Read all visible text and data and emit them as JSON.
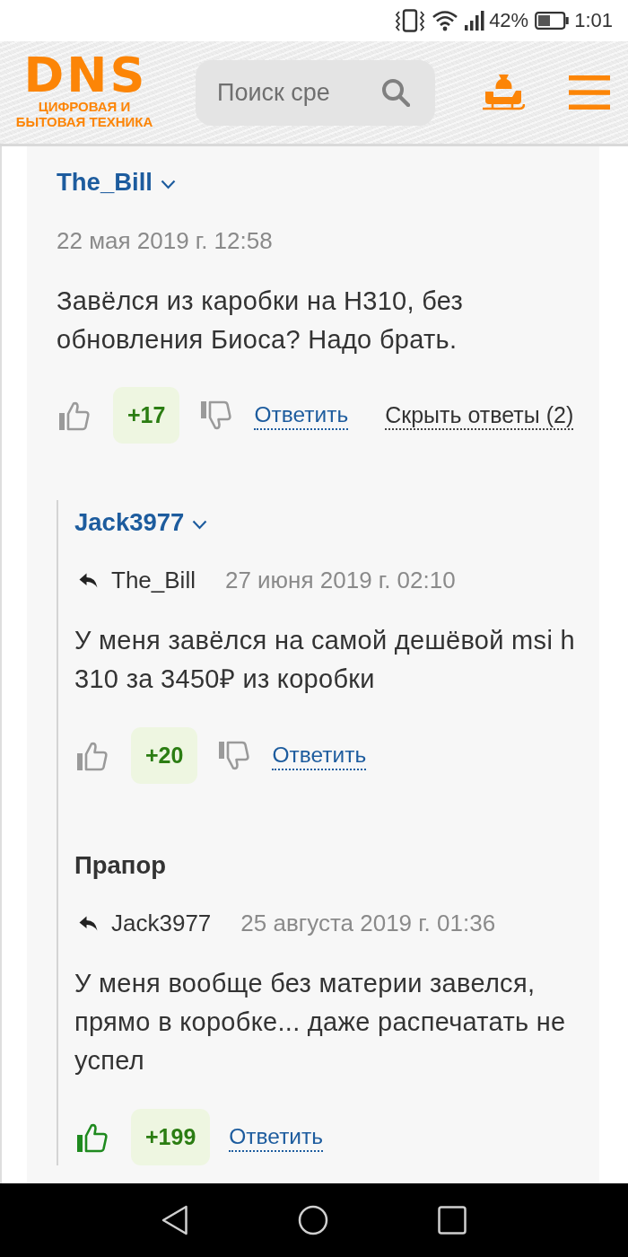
{
  "status_bar": {
    "battery": "42%",
    "time": "1:01"
  },
  "header": {
    "logo": {
      "wordmark": "DNS",
      "tagline": [
        "ЦИФРОВАЯ И",
        "БЫТОВАЯ ТЕХНИКА"
      ]
    },
    "search": {
      "placeholder": "Поиск сре"
    }
  },
  "comments": [
    {
      "author": "The_Bill",
      "author_link": true,
      "date": "22 мая 2019 г. 12:58",
      "text": "Завёлся из каробки на H310, без обновления Биоса? Надо брать.",
      "rating": "+17",
      "liked": false,
      "reply_label": "Ответить",
      "toggle_replies": "Скрыть ответы (2)",
      "replies": [
        {
          "author": "Jack3977",
          "author_link": true,
          "reply_to": "The_Bill",
          "date": "27 июня 2019 г. 02:10",
          "text": "У меня завёлся на самой дешёвой msi h 310 за 3450₽ из коробки",
          "rating": "+20",
          "liked": false,
          "reply_label": "Ответить"
        },
        {
          "author": "Прапор",
          "author_link": false,
          "reply_to": "Jack3977",
          "date": "25 августа 2019 г. 01:36",
          "text": "У меня вообще без материи завелся, прямо в коробке... даже распечатать не успел",
          "rating": "+199",
          "liked": true,
          "reply_label": "Ответить"
        }
      ]
    }
  ]
}
